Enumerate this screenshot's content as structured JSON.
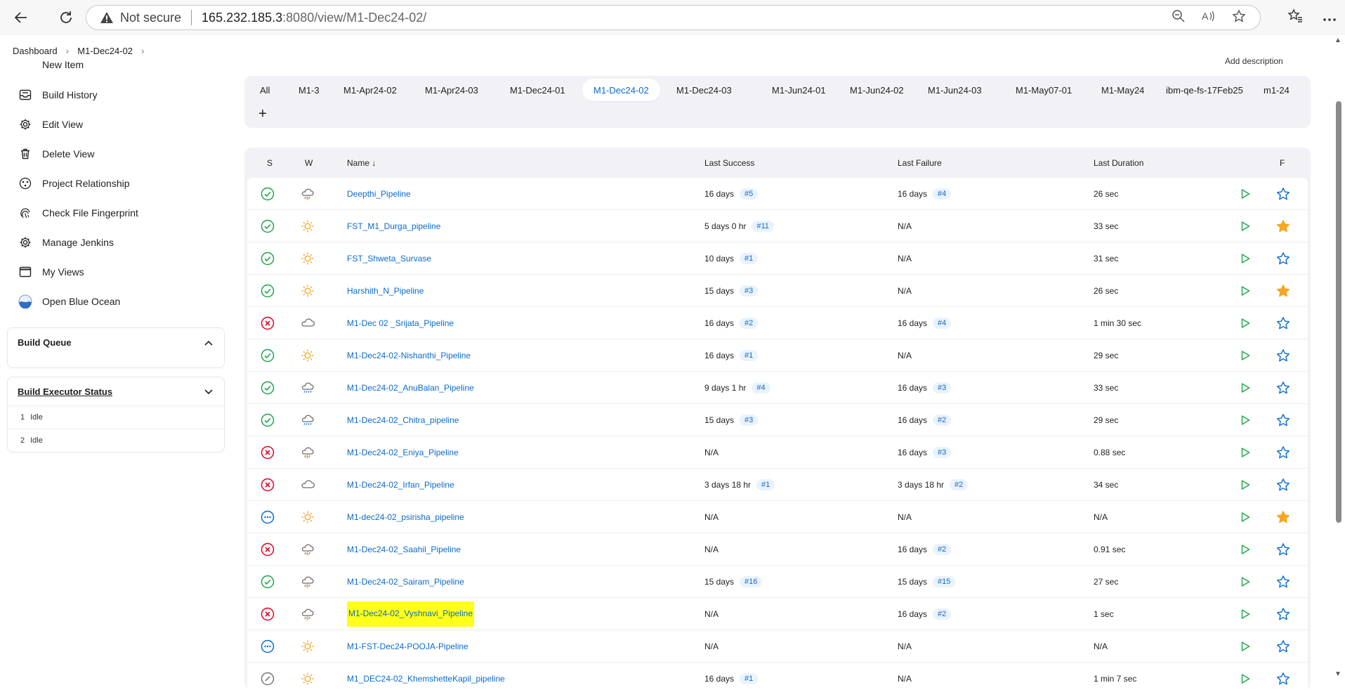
{
  "browser": {
    "not_secure": "Not secure",
    "url_host": "165.232.185.3",
    "url_rest": ":8080/view/M1-Dec24-02/"
  },
  "breadcrumb": {
    "items": [
      "Dashboard",
      "M1-Dec24-02"
    ]
  },
  "sidebar": {
    "items": [
      {
        "label": "New Item",
        "icon": "plus-icon"
      },
      {
        "label": "Build History",
        "icon": "inbox-icon"
      },
      {
        "label": "Edit View",
        "icon": "gear-icon"
      },
      {
        "label": "Delete View",
        "icon": "trash-icon"
      },
      {
        "label": "Project Relationship",
        "icon": "relationship-icon"
      },
      {
        "label": "Check File Fingerprint",
        "icon": "fingerprint-icon"
      },
      {
        "label": "Manage Jenkins",
        "icon": "gear-icon"
      },
      {
        "label": "My Views",
        "icon": "window-icon"
      },
      {
        "label": "Open Blue Ocean",
        "icon": "blue-ocean-icon"
      }
    ],
    "build_queue": {
      "title": "Build Queue"
    },
    "executor": {
      "title": "Build Executor Status",
      "rows": [
        {
          "num": "1",
          "status": "Idle"
        },
        {
          "num": "2",
          "status": "Idle"
        }
      ]
    }
  },
  "add_description": "Add description",
  "tabs": {
    "items": [
      "All",
      "M1-3",
      "M1-Apr24-02",
      "M1-Apr24-03",
      "M1-Dec24-01",
      "M1-Dec24-02",
      "M1-Dec24-03",
      "M1-Jun24-01",
      "M1-Jun24-02",
      "M1-Jun24-03",
      "M1-May07-01",
      "M1-May24",
      "ibm-qe-fs-17Feb25",
      "m1-24"
    ],
    "active": "M1-Dec24-02",
    "add": "+"
  },
  "table": {
    "headers": {
      "s": "S",
      "w": "W",
      "name": "Name",
      "sort": "↓",
      "last_success": "Last Success",
      "last_failure": "Last Failure",
      "last_duration": "Last Duration",
      "f": "F"
    },
    "colors": {
      "success": "#1ea64b",
      "failure": "#e6001f",
      "notbuilt": "#0b6bcb",
      "sun": "#f5a623",
      "cloud": "#6d6d6d",
      "link": "#0b6bcb",
      "highlight": "#ffff19",
      "star": "#f5a623"
    },
    "rows": [
      {
        "status": "success",
        "weather": "storm",
        "name": "Deepthi_Pipeline",
        "ls": "16 days",
        "ls_b": "#5",
        "lf": "16 days",
        "lf_b": "#4",
        "dur": "26 sec",
        "fav": false
      },
      {
        "status": "success",
        "weather": "sunny",
        "name": "FST_M1_Durga_pipeline",
        "ls": "5 days 0 hr",
        "ls_b": "#11",
        "lf": "N/A",
        "lf_b": "",
        "dur": "33 sec",
        "fav": true
      },
      {
        "status": "success",
        "weather": "sunny",
        "name": "FST_Shweta_Survase",
        "ls": "10 days",
        "ls_b": "#1",
        "lf": "N/A",
        "lf_b": "",
        "dur": "31 sec",
        "fav": false
      },
      {
        "status": "success",
        "weather": "sunny",
        "name": "Harshith_N_Pipeline",
        "ls": "15 days",
        "ls_b": "#3",
        "lf": "N/A",
        "lf_b": "",
        "dur": "26 sec",
        "fav": true
      },
      {
        "status": "failure",
        "weather": "cloudy",
        "name": "M1-Dec 02 _Srijata_Pipeline",
        "ls": "16 days",
        "ls_b": "#2",
        "lf": "16 days",
        "lf_b": "#4",
        "dur": "1 min 30 sec",
        "fav": false
      },
      {
        "status": "success",
        "weather": "sunny",
        "name": "M1-Dec24-02-Nishanthi_Pipeline",
        "ls": "16 days",
        "ls_b": "#1",
        "lf": "N/A",
        "lf_b": "",
        "dur": "29 sec",
        "fav": false
      },
      {
        "status": "success",
        "weather": "rain",
        "name": "M1-Dec24-02_AnuBalan_Pipeline",
        "ls": "9 days 1 hr",
        "ls_b": "#4",
        "lf": "16 days",
        "lf_b": "#3",
        "dur": "33 sec",
        "fav": false
      },
      {
        "status": "success",
        "weather": "rain",
        "name": "M1-Dec24-02_Chitra_pipeline",
        "ls": "15 days",
        "ls_b": "#3",
        "lf": "16 days",
        "lf_b": "#2",
        "dur": "29 sec",
        "fav": false
      },
      {
        "status": "failure",
        "weather": "storm",
        "name": "M1-Dec24-02_Eniya_Pipeline",
        "ls": "N/A",
        "ls_b": "",
        "lf": "16 days",
        "lf_b": "#3",
        "dur": "0.88 sec",
        "fav": false
      },
      {
        "status": "failure",
        "weather": "cloudy",
        "name": "M1-Dec24-02_Irfan_Pipeline",
        "ls": "3 days 18 hr",
        "ls_b": "#1",
        "lf": "3 days 18 hr",
        "lf_b": "#2",
        "dur": "34 sec",
        "fav": false
      },
      {
        "status": "notbuilt",
        "weather": "sunny",
        "name": "M1-dec24-02_psirisha_pipeline",
        "ls": "N/A",
        "ls_b": "",
        "lf": "N/A",
        "lf_b": "",
        "dur": "N/A",
        "fav": true
      },
      {
        "status": "failure",
        "weather": "storm",
        "name": "M1-Dec24-02_Saahil_Pipeline",
        "ls": "N/A",
        "ls_b": "",
        "lf": "16 days",
        "lf_b": "#2",
        "dur": "0.91 sec",
        "fav": false
      },
      {
        "status": "success",
        "weather": "storm",
        "name": "M1-Dec24-02_Sairam_Pipeline",
        "ls": "15 days",
        "ls_b": "#16",
        "lf": "15 days",
        "lf_b": "#15",
        "dur": "27 sec",
        "fav": false
      },
      {
        "status": "failure",
        "weather": "storm",
        "name": "M1-Dec24-02_Vyshnavi_Pipeline",
        "ls": "N/A",
        "ls_b": "",
        "lf": "16 days",
        "lf_b": "#2",
        "dur": "1 sec",
        "fav": false,
        "highlight": true
      },
      {
        "status": "notbuilt",
        "weather": "sunny",
        "name": "M1-FST-Dec24-POOJA-Pipeline",
        "ls": "N/A",
        "ls_b": "",
        "lf": "N/A",
        "lf_b": "",
        "dur": "N/A",
        "fav": false
      },
      {
        "status": "aborted",
        "weather": "sunny",
        "name": "M1_DEC24-02_KhemshetteKapil_pipeline",
        "ls": "16 days",
        "ls_b": "#1",
        "lf": "N/A",
        "lf_b": "",
        "dur": "1 min 7 sec",
        "fav": false
      }
    ]
  }
}
